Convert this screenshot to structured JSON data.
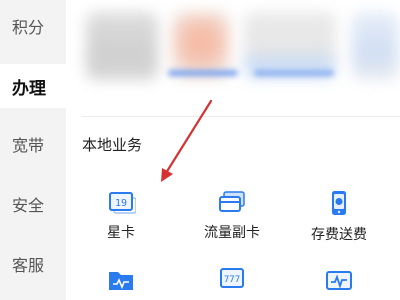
{
  "sidebar": {
    "items": [
      {
        "label": "积分"
      },
      {
        "label": "办理"
      },
      {
        "label": "宽带"
      },
      {
        "label": "安全"
      },
      {
        "label": "客服"
      }
    ]
  },
  "section": {
    "title": "本地业务"
  },
  "services": [
    {
      "label": "星卡",
      "icon": "star-card-icon",
      "icon_text": "19"
    },
    {
      "label": "流量副卡",
      "icon": "data-sub-card-icon"
    },
    {
      "label": "存费送费",
      "icon": "deposit-phone-icon"
    },
    {
      "label": "",
      "icon": "folder-wave-icon"
    },
    {
      "label": "",
      "icon": "number-card-icon",
      "icon_text": "777"
    },
    {
      "label": "",
      "icon": "signal-card-icon"
    }
  ],
  "colors": {
    "accent_blue": "#2a7bf0",
    "arrow_red": "#d63232"
  }
}
